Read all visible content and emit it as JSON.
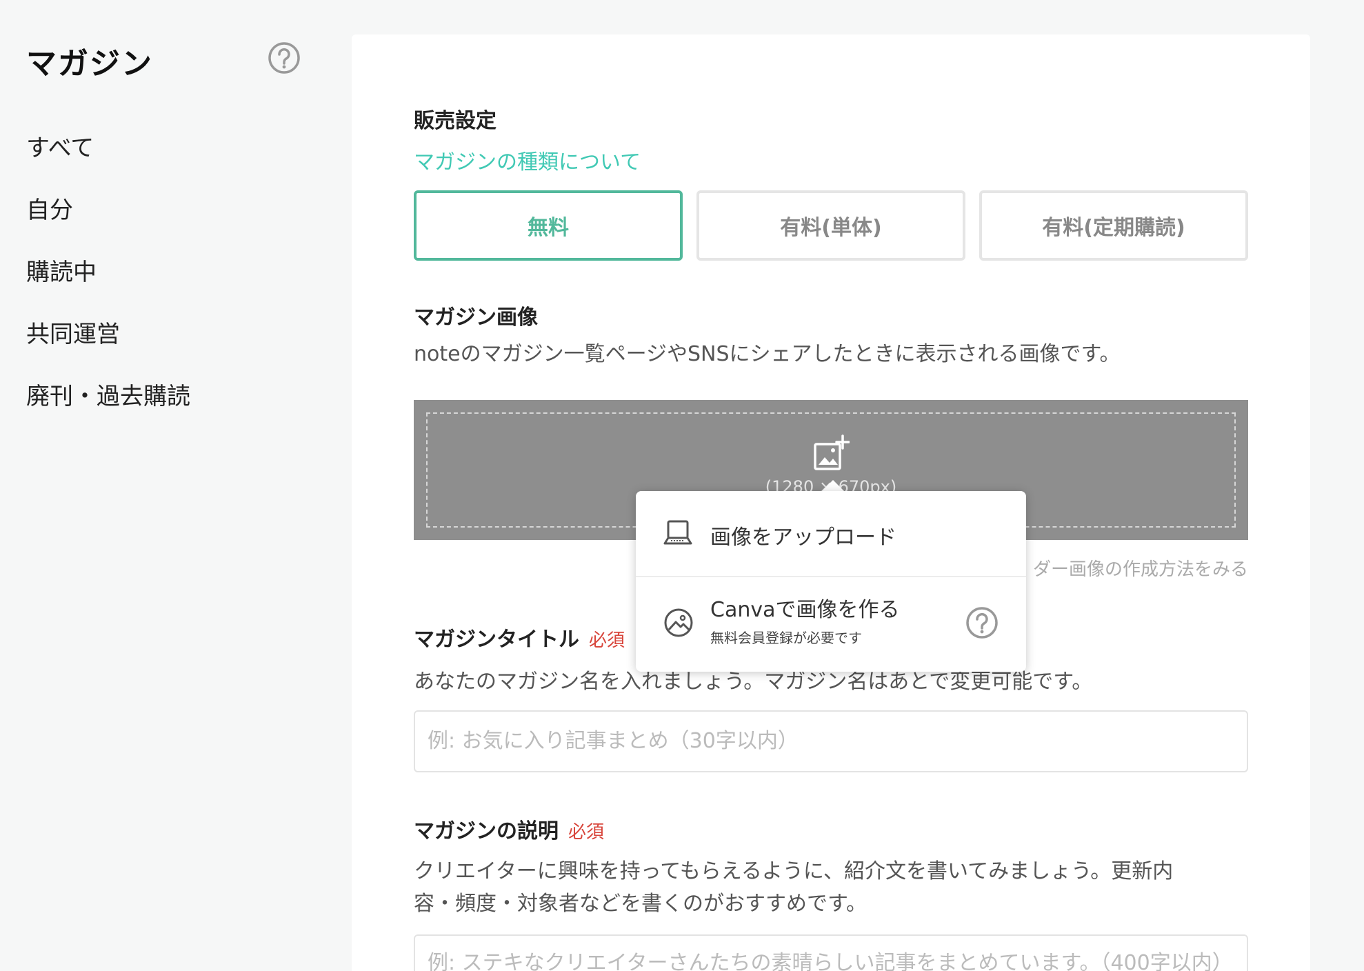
{
  "sidebar": {
    "title": "マガジン",
    "help_icon": "question-circle-icon",
    "items": [
      {
        "label": "すべて"
      },
      {
        "label": "自分"
      },
      {
        "label": "購読中"
      },
      {
        "label": "共同運営"
      },
      {
        "label": "廃刊・過去購読"
      }
    ]
  },
  "sales": {
    "title": "販売設定",
    "link": "マガジンの種類について",
    "options": [
      {
        "label": "無料",
        "selected": true
      },
      {
        "label": "有料(単体)",
        "selected": false
      },
      {
        "label": "有料(定期購読)",
        "selected": false
      }
    ]
  },
  "image": {
    "title": "マガジン画像",
    "description": "noteのマガジン一覧ページやSNSにシェアしたときに表示される画像です。",
    "size_hint": "(1280 × 670px)",
    "howto_link": "ダー画像の作成方法をみる",
    "upload_icon": "add-image-icon"
  },
  "popover": {
    "upload_label": "画像をアップロード",
    "upload_icon": "laptop-icon",
    "canva_label": "Canvaで画像を作る",
    "canva_sub": "無料会員登録が必要です",
    "canva_icon": "image-circle-icon",
    "help_icon": "question-circle-icon"
  },
  "title_field": {
    "title": "マガジンタイトル",
    "required": "必須",
    "description": "あなたのマガジン名を入れましょう。マガジン名はあとで変更可能です。",
    "placeholder": "例: お気に入り記事まとめ（30字以内）"
  },
  "desc_field": {
    "title": "マガジンの説明",
    "required": "必須",
    "description": "クリエイターに興味を持ってもらえるように、紹介文を書いてみましょう。更新内容・頻度・対象者などを書くのがおすすめです。",
    "placeholder": "例: ステキなクリエイターさんたちの素晴らしい記事をまとめています。（400字以内）"
  },
  "colors": {
    "accent": "#52b89b",
    "link": "#41c9b4",
    "required": "#d8453b",
    "upload_bg": "#8e8e8e"
  }
}
